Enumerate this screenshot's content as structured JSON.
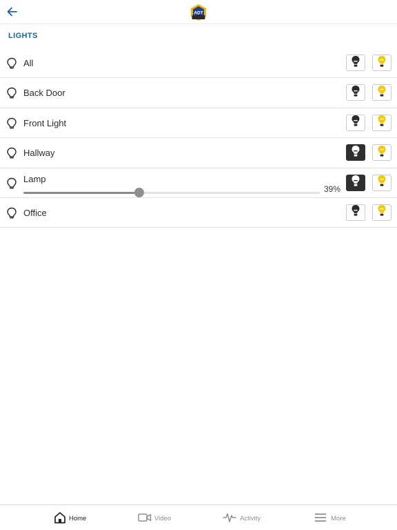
{
  "header": {
    "back_icon": "arrow-left-icon",
    "logo": "adt-logo",
    "logo_text": "ADT"
  },
  "section": {
    "title": "LIGHTS"
  },
  "lights": [
    {
      "name": "All",
      "state": "none"
    },
    {
      "name": "Back Door",
      "state": "none"
    },
    {
      "name": "Front Light",
      "state": "none"
    },
    {
      "name": "Hallway",
      "state": "off"
    },
    {
      "name": "Lamp",
      "state": "off",
      "dimmer": true,
      "level": 39,
      "level_text": "39%"
    },
    {
      "name": "Office",
      "state": "none"
    }
  ],
  "tabs": [
    {
      "label": "Home",
      "icon": "home-icon",
      "active": true
    },
    {
      "label": "Video",
      "icon": "video-camera-icon",
      "active": false
    },
    {
      "label": "Activity",
      "icon": "activity-pulse-icon",
      "active": false
    },
    {
      "label": "More",
      "icon": "menu-lines-icon",
      "active": false
    }
  ],
  "colors": {
    "accent": "#1a5fb4",
    "bulb_on": "#f5c800",
    "button_active": "#2f2f2f"
  }
}
